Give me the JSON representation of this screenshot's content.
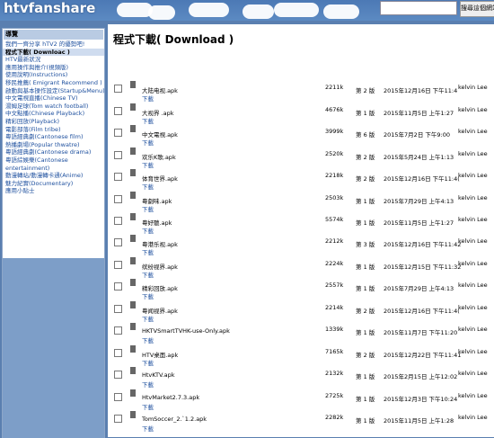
{
  "header": {
    "logo": "htvfanshare",
    "search_placeholder": "",
    "search_button": "搜尋這個網站"
  },
  "sidebar": {
    "title": "導覽",
    "items": [
      {
        "label": "我們一齊分享 hTV2 的優勢吧!",
        "active": false
      },
      {
        "label": "程式下載( Downloac )",
        "active": true
      },
      {
        "label": "HTV最新狀況",
        "active": false
      },
      {
        "label": "應用操作與推介(視頻版)",
        "active": false
      },
      {
        "label": "使用說明(Instructions)",
        "active": false
      },
      {
        "label": "移民推薦( Emigrant Recommend )",
        "active": false
      },
      {
        "label": "啟動與基本操作設定(Startup&Menu)",
        "active": false
      },
      {
        "label": "中文電視直播(Chinese TV)",
        "active": false
      },
      {
        "label": "湯姆足球(Tom watch football)",
        "active": false
      },
      {
        "label": "中文點播(Chinese Playback)",
        "active": false
      },
      {
        "label": "精彩回放(Playback)",
        "active": false
      },
      {
        "label": "電影部落(Film tribe)",
        "active": false
      },
      {
        "label": "粵語經典劇(Cantonese film)",
        "active": false
      },
      {
        "label": "熱播劇場(Popular thwatre)",
        "active": false
      },
      {
        "label": "粵語經典劇(Cantonese drama)",
        "active": false
      },
      {
        "label": "粵語綜娛樂(Cantonese entertainment)",
        "active": false
      },
      {
        "label": "動漫轉站/動漫轉卡通(Anime)",
        "active": false
      },
      {
        "label": "魅力紀實(Documentary)",
        "active": false
      },
      {
        "label": "應用小貼士",
        "active": false
      }
    ]
  },
  "main": {
    "title": "程式下載( Download )",
    "download_label": "下載",
    "files": [
      {
        "name": "大陆电视.apk",
        "size": "2211k",
        "version": "第 2 版",
        "date": "2015年12月16日 下午11:4",
        "author": "kelvin Lee"
      },
      {
        "name": "大视界 .apk",
        "size": "4676k",
        "version": "第 1 版",
        "date": "2015年11月5日 上午1:27",
        "author": "kelvin Lee"
      },
      {
        "name": "中文電視.apk",
        "size": "3999k",
        "version": "第 6 版",
        "date": "2015年7月2日 下午9:00",
        "author": "kelvin Lee"
      },
      {
        "name": "欢乐K歌.apk",
        "size": "2520k",
        "version": "第 2 版",
        "date": "2015年5月24日 上午1:13",
        "author": "kelvin Lee"
      },
      {
        "name": "体育世界.apk",
        "size": "2218k",
        "version": "第 2 版",
        "date": "2015年12月16日 下午11:4(",
        "author": "kelvin Lee"
      },
      {
        "name": "粵劇味.apk",
        "size": "2503k",
        "version": "第 1 版",
        "date": "2015年7月29日 上午4:13",
        "author": "kelvin Lee"
      },
      {
        "name": "粵好聽.apk",
        "size": "5574k",
        "version": "第 1 版",
        "date": "2015年11月5日 上午1:27",
        "author": "kelvin Lee"
      },
      {
        "name": "粵港乐视.apk",
        "size": "2212k",
        "version": "第 3 版",
        "date": "2015年12月16日 下午11:42",
        "author": "kelvin Lee"
      },
      {
        "name": "缤纷视界.apk",
        "size": "2224k",
        "version": "第 1 版",
        "date": "2015年12月15日 下午11:32",
        "author": "kelvin Lee"
      },
      {
        "name": "精彩回放.apk",
        "size": "2557k",
        "version": "第 1 版",
        "date": "2015年7月29日 上午4:13",
        "author": "kelvin Lee"
      },
      {
        "name": "粵闻视界.apk",
        "size": "2214k",
        "version": "第 2 版",
        "date": "2015年12月16日 下午11:4(",
        "author": "kelvin Lee"
      },
      {
        "name": "HKTVSmartTVHK-use-Only.apk",
        "size": "1339k",
        "version": "第 1 版",
        "date": "2015年11月7日 下午11:20",
        "author": "kelvin Lee"
      },
      {
        "name": "HTV桌面.apk",
        "size": "7165k",
        "version": "第 2 版",
        "date": "2015年12月22日 下午11:41",
        "author": "kelvin Lee"
      },
      {
        "name": "HtvKTV.apk",
        "size": "2132k",
        "version": "第 1 版",
        "date": "2015年2月15日 上午12:02",
        "author": "kelvin Lee"
      },
      {
        "name": "HtvMarket2.7.3.apk",
        "size": "2725k",
        "version": "第 1 版",
        "date": "2015年12月3日 下午10:24",
        "author": "kelvin Lee"
      },
      {
        "name": "TomSoccer_2.`1.2.apk",
        "size": "2282k",
        "version": "第 1 版",
        "date": "2015年11月5日 上午1:28",
        "author": "kelvin Lee"
      }
    ]
  }
}
